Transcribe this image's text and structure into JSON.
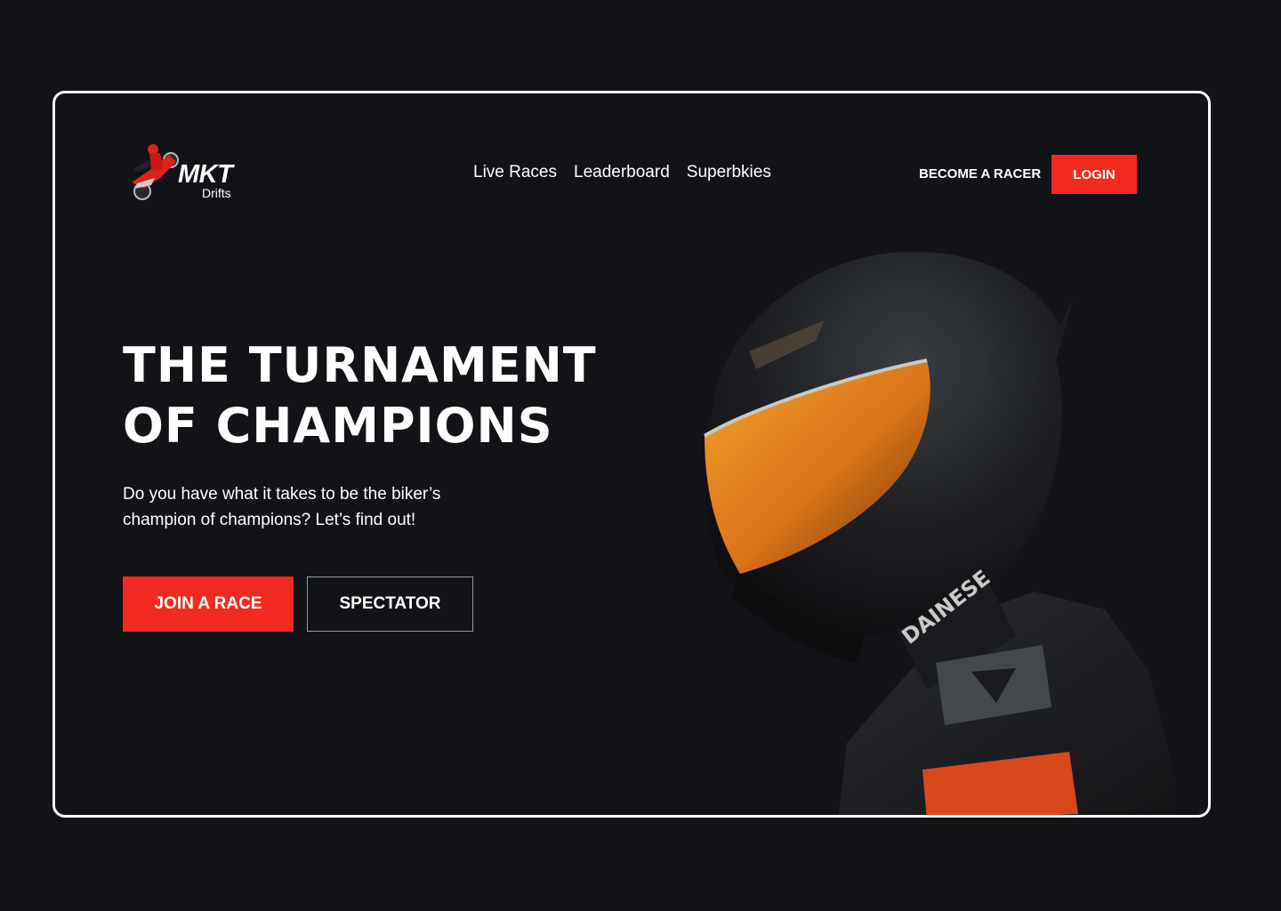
{
  "header": {
    "logo_title": "MKT",
    "logo_subtitle": "Drifts",
    "nav": [
      {
        "label": "Live Races"
      },
      {
        "label": "Leaderboard"
      },
      {
        "label": "Superbkies"
      }
    ],
    "become_racer": "BECOME A RACER",
    "login": "LOGIN"
  },
  "hero": {
    "title_line1": "THE TURNAMENT",
    "title_line2": "OF CHAMPIONS",
    "subtitle": "Do you have what it takes to be the biker’s champion of champions? Let’s find out!",
    "join_button": "JOIN A RACE",
    "spectator_button": "SPECTATOR",
    "jacket_text": "DAINESE"
  },
  "colors": {
    "background": "#111316",
    "accent": "#f32a1f",
    "text": "#ffffff",
    "visor": "#e98a1c"
  },
  "icons": {
    "logo": "motorcycle-rider-icon"
  }
}
